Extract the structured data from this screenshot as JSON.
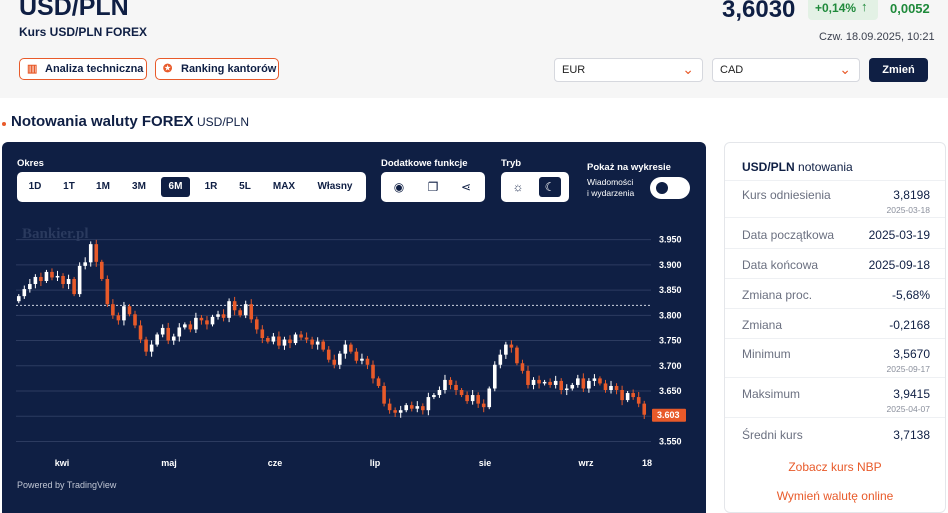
{
  "header": {
    "pair": "USD/PLN",
    "subtitle": "Kurs USD/PLN FOREX",
    "price": "3,6030",
    "change_pct": "+0,14%",
    "change_abs": "0,0052",
    "datetime": "Czw. 18.09.2025, 10:21",
    "buttons": {
      "analysis": "Analiza techniczna",
      "ranking": "Ranking kantorów"
    },
    "currency_from": "EUR",
    "currency_to": "CAD",
    "change_button": "Zmień"
  },
  "section": {
    "title": "Notowania waluty FOREX",
    "subtitle": "USD/PLN"
  },
  "chart_controls": {
    "period_label": "Okres",
    "periods": [
      "1D",
      "1T",
      "1M",
      "3M",
      "6M",
      "1R",
      "5L",
      "MAX",
      "Własny"
    ],
    "active_period": "6M",
    "extra_label": "Dodatkowe funkcje",
    "mode_label": "Tryb",
    "show_label": "Pokaż na wykresie",
    "events_label_1": "Wiadomości",
    "events_label_2": "i wydarzenia",
    "watermark": "Bankier.pl",
    "credit": "Powered by TradingView"
  },
  "chart_data": {
    "type": "candlestick",
    "x_ticks": [
      "kwi",
      "maj",
      "cze",
      "lip",
      "sie",
      "wrz",
      "18"
    ],
    "y_ticks": [
      "3.950",
      "3.900",
      "3.850",
      "3.800",
      "3.750",
      "3.700",
      "3.650",
      "3.600",
      "3.550"
    ],
    "ylim": [
      3.545,
      3.975
    ],
    "reference_line": 3.8198,
    "last_price_label": "3.603",
    "last_price": 3.603,
    "up_color": "#ffffff",
    "down_color": "#e85a2a",
    "closes": [
      3.838,
      3.852,
      3.862,
      3.876,
      3.868,
      3.886,
      3.875,
      3.878,
      3.862,
      3.872,
      3.842,
      3.898,
      3.905,
      3.941,
      3.906,
      3.872,
      3.822,
      3.8,
      3.79,
      3.818,
      3.802,
      3.78,
      3.752,
      3.728,
      3.742,
      3.762,
      3.775,
      3.75,
      3.758,
      3.776,
      3.782,
      3.772,
      3.795,
      3.79,
      3.782,
      3.797,
      3.802,
      3.795,
      3.828,
      3.81,
      3.8,
      3.822,
      3.792,
      3.772,
      3.755,
      3.748,
      3.758,
      3.74,
      3.752,
      3.745,
      3.762,
      3.756,
      3.752,
      3.742,
      3.748,
      3.732,
      3.712,
      3.702,
      3.724,
      3.742,
      3.728,
      3.71,
      3.714,
      3.702,
      3.675,
      3.66,
      3.625,
      3.612,
      3.607,
      3.612,
      3.622,
      3.615,
      3.62,
      3.612,
      3.638,
      3.642,
      3.652,
      3.672,
      3.662,
      3.652,
      3.642,
      3.63,
      3.642,
      3.625,
      3.618,
      3.655,
      3.702,
      3.722,
      3.742,
      3.736,
      3.705,
      3.69,
      3.662,
      3.672,
      3.665,
      3.668,
      3.662,
      3.67,
      3.652,
      3.655,
      3.662,
      3.675,
      3.655,
      3.67,
      3.675,
      3.665,
      3.652,
      3.66,
      3.652,
      3.632,
      3.646,
      3.638,
      3.625,
      3.603
    ]
  },
  "sidebar": {
    "title_bold": "USD/PLN",
    "title_rest": "notowania",
    "rows": [
      {
        "label": "Kurs odniesienia",
        "value": "3,8198",
        "date": "2025-03-18"
      },
      {
        "label": "Data początkowa",
        "value": "2025-03-19"
      },
      {
        "label": "Data końcowa",
        "value": "2025-09-18"
      },
      {
        "label": "Zmiana proc.",
        "value": "-5,68%"
      },
      {
        "label": "Zmiana",
        "value": "-0,2168"
      },
      {
        "label": "Minimum",
        "value": "3,5670",
        "date": "2025-09-17"
      },
      {
        "label": "Maksimum",
        "value": "3,9415",
        "date": "2025-04-07"
      },
      {
        "label": "Średni kurs",
        "value": "3,7138"
      }
    ],
    "link_nbp": "Zobacz kurs NBP",
    "link_exchange": "Wymień walutę online"
  }
}
